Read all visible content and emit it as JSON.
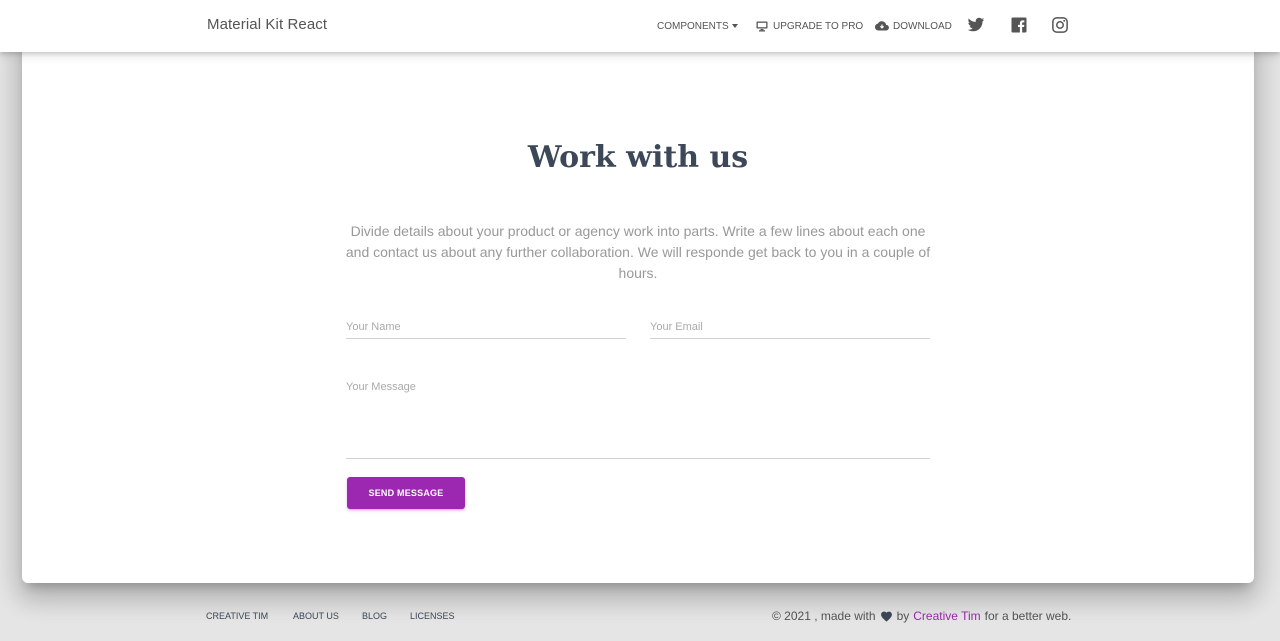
{
  "header": {
    "brand": "Material Kit React",
    "nav": {
      "components": "COMPONENTS",
      "upgrade": "UPGRADE TO PRO",
      "download": "DOWNLOAD"
    },
    "icons": [
      "monitor-icon",
      "cloud-download-icon",
      "twitter-icon",
      "facebook-icon",
      "instagram-icon"
    ]
  },
  "section": {
    "title": "Work with us",
    "description": "Divide details about your product or agency work into parts. Write a few lines about each one and contact us about any further collaboration. We will responde get back to you in a couple of hours.",
    "form": {
      "name_label": "Your Name",
      "email_label": "Your Email",
      "message_label": "Your Message",
      "send_label": "SEND MESSAGE"
    }
  },
  "footer": {
    "links": [
      "CREATIVE TIM",
      "ABOUT US",
      "BLOG",
      "LICENSES"
    ],
    "copy_prefix": "© 2021 , made with",
    "copy_by": "by",
    "copy_brand": "Creative Tim",
    "copy_suffix": "for a better web."
  },
  "colors": {
    "accent": "#9c27b0",
    "title": "#3c4858",
    "muted": "#999999",
    "background": "#e5e5e5"
  }
}
